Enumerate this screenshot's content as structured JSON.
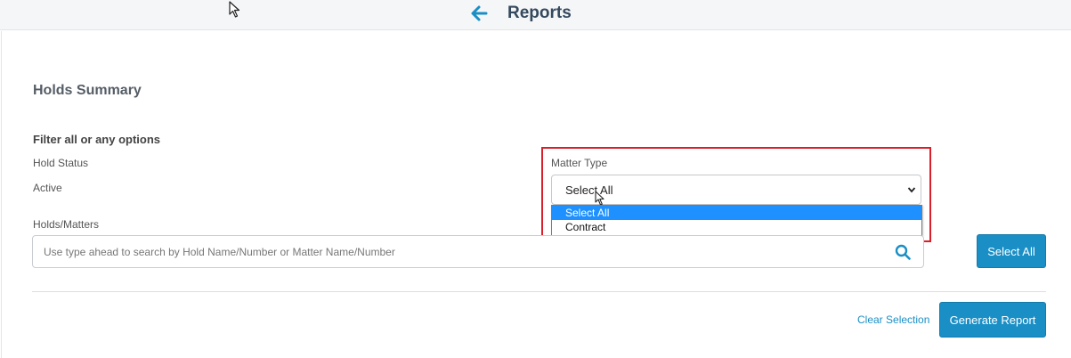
{
  "header": {
    "title": "Reports"
  },
  "report": {
    "title": "Holds Summary",
    "filter_heading": "Filter all or any options",
    "hold_status_label": "Hold Status",
    "hold_status_value": "Active",
    "matter_type_label": "Matter Type",
    "matter_type_selected": "Select All",
    "matter_type_options": [
      "Select All",
      "Contract"
    ],
    "holds_matters_label": "Holds/Matters",
    "search_placeholder": "Use type ahead to search by Hold Name/Number or Matter Name/Number",
    "select_all_button": "Select All",
    "clear_selection_link": "Clear Selection",
    "generate_button": "Generate Report"
  },
  "colors": {
    "accent": "#1a8fc6",
    "highlight": "#d9202a",
    "option_selected": "#1e90ff"
  },
  "icons": {
    "back": "arrow-left-icon",
    "search": "magnifier-icon",
    "dropdown": "chevron-down-icon"
  }
}
